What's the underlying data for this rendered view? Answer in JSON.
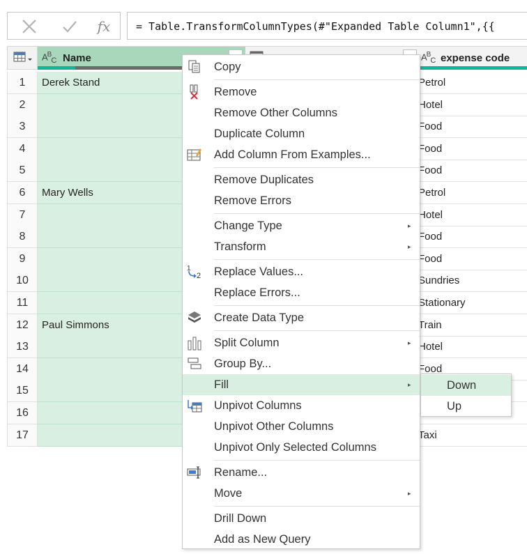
{
  "formula_bar": {
    "cancel_icon": "x-icon",
    "confirm_icon": "check-icon",
    "fx_label": "fx",
    "formula": "= Table.TransformColumnTypes(#\"Expanded Table Column1\",{{"
  },
  "grid": {
    "columns": [
      {
        "name": "Name",
        "type": "ABC"
      },
      {
        "name": "",
        "type": "table"
      },
      {
        "name": "expense code",
        "type": "ABC"
      }
    ],
    "type_label_a": "A",
    "type_label_b": "B",
    "type_label_c": "C",
    "rows": [
      {
        "num": "1",
        "name": "Derek Stand",
        "expense": "Petrol"
      },
      {
        "num": "2",
        "name": "",
        "expense": "Hotel"
      },
      {
        "num": "3",
        "name": "",
        "expense": "Food"
      },
      {
        "num": "4",
        "name": "",
        "expense": "Food"
      },
      {
        "num": "5",
        "name": "",
        "expense": "Food"
      },
      {
        "num": "6",
        "name": "Mary Wells",
        "expense": "Petrol"
      },
      {
        "num": "7",
        "name": "",
        "expense": "Hotel"
      },
      {
        "num": "8",
        "name": "",
        "expense": "Food"
      },
      {
        "num": "9",
        "name": "",
        "expense": "Food"
      },
      {
        "num": "10",
        "name": "",
        "expense": "Sundries"
      },
      {
        "num": "11",
        "name": "",
        "expense": "Stationary"
      },
      {
        "num": "12",
        "name": "Paul Simmons",
        "expense": "Train"
      },
      {
        "num": "13",
        "name": "",
        "expense": "Hotel"
      },
      {
        "num": "14",
        "name": "",
        "expense": "Food"
      },
      {
        "num": "15",
        "name": "",
        "expense": ""
      },
      {
        "num": "16",
        "name": "",
        "expense": ""
      },
      {
        "num": "17",
        "name": "",
        "expense": "Taxi"
      }
    ]
  },
  "context_menu": {
    "items": {
      "copy": "Copy",
      "remove": "Remove",
      "remove_other_columns": "Remove Other Columns",
      "duplicate_column": "Duplicate Column",
      "add_column_from_examples": "Add Column From Examples...",
      "remove_duplicates": "Remove Duplicates",
      "remove_errors": "Remove Errors",
      "change_type": "Change Type",
      "transform": "Transform",
      "replace_values": "Replace Values...",
      "replace_errors": "Replace Errors...",
      "create_data_type": "Create Data Type",
      "split_column": "Split Column",
      "group_by": "Group By...",
      "fill": "Fill",
      "unpivot_columns": "Unpivot Columns",
      "unpivot_other_columns": "Unpivot Other Columns",
      "unpivot_only_selected_columns": "Unpivot Only Selected Columns",
      "rename": "Rename...",
      "move": "Move",
      "drill_down": "Drill Down",
      "add_as_new_query": "Add as New Query"
    },
    "submenu_arrow": "▸",
    "replace_icon_top": "1",
    "replace_icon_bottom": "2",
    "highlighted": "fill"
  },
  "fill_submenu": {
    "down": "Down",
    "up": "Up",
    "highlighted": "down"
  },
  "colors": {
    "selected_column": "#d9efe1",
    "header_selected": "#a9d7bc",
    "quality_bar": "#12b59c"
  }
}
